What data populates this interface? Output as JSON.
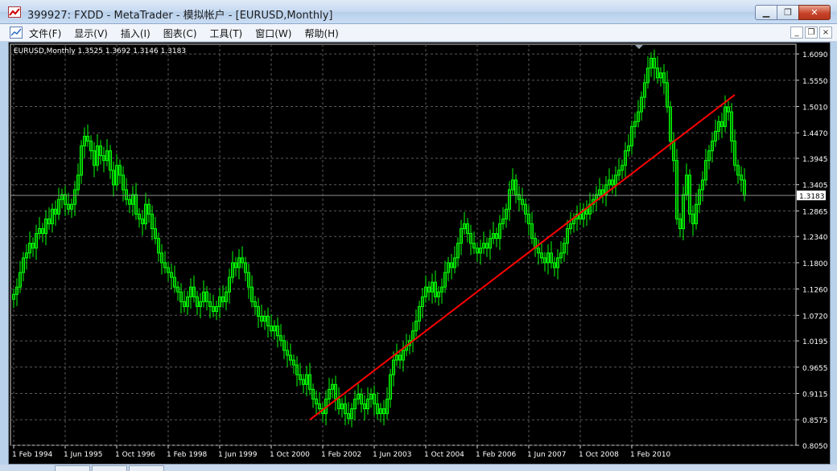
{
  "window": {
    "title": "399927: FXDD - MetaTrader - 模拟帐户 - [EURUSD,Monthly]",
    "icon": "metatrader-icon",
    "buttons": [
      {
        "name": "minimize-icon",
        "glyph": "▁"
      },
      {
        "name": "maximize-icon",
        "glyph": "❐"
      },
      {
        "name": "close-icon",
        "glyph": "✕"
      }
    ]
  },
  "menu": {
    "items": [
      "文件(F)",
      "显示(V)",
      "插入(I)",
      "图表(C)",
      "工具(T)",
      "窗口(W)",
      "帮助(H)"
    ],
    "mdi_buttons": [
      "_",
      "❐",
      "×"
    ]
  },
  "chart_data": {
    "type": "candlestick",
    "symbol_label": "EURUSD,Monthly",
    "ohlc_label": "1.3525 1.3692 1.3146 1.3183",
    "current_price": 1.3183,
    "colors": {
      "background": "#000000",
      "candles": "#00ff00",
      "grid": "#5a5a5a",
      "trendline": "#ff0000",
      "axis_text": "#ffffff"
    },
    "grid": true,
    "ylim": [
      0.805,
      1.629
    ],
    "y_ticks": [
      "1.6090",
      "1.5550",
      "1.5010",
      "1.4470",
      "1.3945",
      "1.3405",
      "1.2865",
      "1.2340",
      "1.1800",
      "1.1260",
      "1.0720",
      "1.0195",
      "0.9655",
      "0.9115",
      "0.8575",
      "0.8050"
    ],
    "x_ticks": [
      "1 Feb 1994",
      "1 Jun 1995",
      "1 Oct 1996",
      "1 Feb 1998",
      "1 Jun 1999",
      "1 Oct 2000",
      "1 Feb 2002",
      "1 Jun 2003",
      "1 Oct 2004",
      "1 Feb 2006",
      "1 Jun 2007",
      "1 Oct 2008",
      "1 Feb 2010"
    ],
    "x_start": "1994-02",
    "series_closes": [
      1.115,
      1.13,
      1.16,
      1.19,
      1.2,
      1.22,
      1.21,
      1.24,
      1.25,
      1.24,
      1.27,
      1.26,
      1.29,
      1.28,
      1.31,
      1.32,
      1.3,
      1.29,
      1.3,
      1.33,
      1.36,
      1.42,
      1.44,
      1.43,
      1.41,
      1.38,
      1.42,
      1.4,
      1.39,
      1.41,
      1.37,
      1.34,
      1.38,
      1.36,
      1.33,
      1.31,
      1.3,
      1.32,
      1.28,
      1.27,
      1.26,
      1.3,
      1.28,
      1.25,
      1.23,
      1.2,
      1.18,
      1.17,
      1.16,
      1.15,
      1.13,
      1.12,
      1.1,
      1.09,
      1.11,
      1.13,
      1.11,
      1.09,
      1.1,
      1.12,
      1.1,
      1.09,
      1.08,
      1.09,
      1.11,
      1.1,
      1.12,
      1.15,
      1.18,
      1.17,
      1.19,
      1.18,
      1.16,
      1.13,
      1.1,
      1.09,
      1.07,
      1.06,
      1.07,
      1.05,
      1.04,
      1.05,
      1.03,
      1.02,
      1.0,
      0.99,
      0.98,
      0.97,
      0.95,
      0.94,
      0.93,
      0.95,
      0.92,
      0.9,
      0.89,
      0.88,
      0.87,
      0.9,
      0.92,
      0.93,
      0.9,
      0.88,
      0.89,
      0.87,
      0.86,
      0.88,
      0.9,
      0.91,
      0.89,
      0.88,
      0.9,
      0.91,
      0.89,
      0.87,
      0.88,
      0.87,
      0.9,
      0.95,
      0.98,
      0.99,
      0.98,
      1.0,
      1.01,
      1.02,
      1.04,
      1.06,
      1.09,
      1.11,
      1.13,
      1.12,
      1.14,
      1.11,
      1.12,
      1.13,
      1.16,
      1.18,
      1.17,
      1.19,
      1.22,
      1.25,
      1.26,
      1.24,
      1.22,
      1.21,
      1.2,
      1.21,
      1.22,
      1.21,
      1.23,
      1.24,
      1.23,
      1.26,
      1.27,
      1.29,
      1.33,
      1.35,
      1.32,
      1.31,
      1.3,
      1.28,
      1.26,
      1.23,
      1.21,
      1.2,
      1.19,
      1.18,
      1.2,
      1.18,
      1.17,
      1.19,
      1.2,
      1.22,
      1.25,
      1.26,
      1.27,
      1.28,
      1.27,
      1.29,
      1.28,
      1.3,
      1.31,
      1.32,
      1.33,
      1.32,
      1.34,
      1.35,
      1.34,
      1.36,
      1.37,
      1.38,
      1.41,
      1.42,
      1.46,
      1.47,
      1.49,
      1.52,
      1.55,
      1.58,
      1.6,
      1.58,
      1.56,
      1.57,
      1.55,
      1.5,
      1.43,
      1.39,
      1.27,
      1.25,
      1.32,
      1.36,
      1.28,
      1.26,
      1.3,
      1.33,
      1.35,
      1.39,
      1.41,
      1.43,
      1.45,
      1.47,
      1.46,
      1.5,
      1.49,
      1.43,
      1.38,
      1.36,
      1.35,
      1.3183
    ],
    "trendline": {
      "from": {
        "x": "2001-10",
        "y": 0.8575
      },
      "to": {
        "x": "2012-10",
        "y": 1.525
      }
    }
  }
}
